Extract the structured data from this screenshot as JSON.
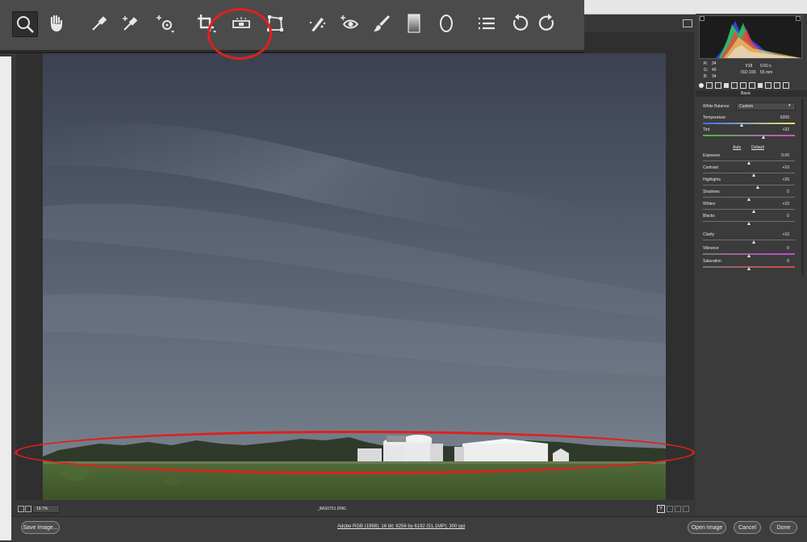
{
  "toolbar": {
    "tools": [
      {
        "id": "zoom",
        "icon": "zoom-icon",
        "active": true
      },
      {
        "id": "hand",
        "icon": "hand-icon"
      },
      {
        "id": "white-balance",
        "icon": "eyedropper-icon"
      },
      {
        "id": "color-sampler",
        "icon": "color-sampler-icon"
      },
      {
        "id": "targeted-adjustment",
        "icon": "targeted-adjustment-icon"
      },
      {
        "id": "crop",
        "icon": "crop-icon"
      },
      {
        "id": "straighten",
        "icon": "straighten-level-icon"
      },
      {
        "id": "transform",
        "icon": "transform-icon"
      },
      {
        "id": "spot-removal",
        "icon": "spot-removal-icon"
      },
      {
        "id": "red-eye",
        "icon": "red-eye-icon"
      },
      {
        "id": "adjustment-brush",
        "icon": "brush-icon"
      },
      {
        "id": "graduated-filter",
        "icon": "graduated-filter-icon"
      },
      {
        "id": "radial-filter",
        "icon": "radial-filter-icon"
      },
      {
        "id": "preferences",
        "icon": "list-icon"
      },
      {
        "id": "rotate-left",
        "icon": "rotate-ccw-icon"
      },
      {
        "id": "rotate-right",
        "icon": "rotate-cw-icon"
      }
    ]
  },
  "info": {
    "r_label": "R:",
    "r_val": "34",
    "g_label": "G:",
    "g_val": "40",
    "b_label": "B:",
    "b_val": "34",
    "aperture": "f/18",
    "shutter": "0.60 s",
    "iso": "ISO 100",
    "focal": "55 mm"
  },
  "panel": {
    "title": "Basic",
    "wb_label": "White Balance:",
    "wb_value": "Custom",
    "auto_label": "Auto",
    "default_label": "Default",
    "sliders": [
      {
        "label": "Temperature",
        "value": "6200",
        "level": 0.42
      },
      {
        "label": "Tint",
        "value": "+32",
        "level": 0.66
      },
      {
        "label": "Exposure",
        "value": "0.00",
        "level": 0.5
      },
      {
        "label": "Contrast",
        "value": "+10",
        "level": 0.55
      },
      {
        "label": "Highlights",
        "value": "+20",
        "level": 0.6
      },
      {
        "label": "Shadows",
        "value": "0",
        "level": 0.5
      },
      {
        "label": "Whites",
        "value": "+10",
        "level": 0.55
      },
      {
        "label": "Blacks",
        "value": "0",
        "level": 0.5
      },
      {
        "label": "Clarity",
        "value": "+10",
        "level": 0.55
      },
      {
        "label": "Vibrance",
        "value": "0",
        "level": 0.5
      },
      {
        "label": "Saturation",
        "value": "0",
        "level": 0.5
      }
    ]
  },
  "zoom_level": "19.7%",
  "filename": "_IMG0751.DNG",
  "workflow_link": "Adobe RGB (1998); 16 bit; 8256 by 6192 (51.1MP); 300 ppi",
  "buttons": {
    "save": "Save Image...",
    "open": "Open Image",
    "cancel": "Cancel",
    "done": "Done"
  },
  "colors": {
    "annotation_red": "#e0201c",
    "toolbar_bg": "#4b4b4b",
    "panel_bg": "#3b3b3b"
  }
}
